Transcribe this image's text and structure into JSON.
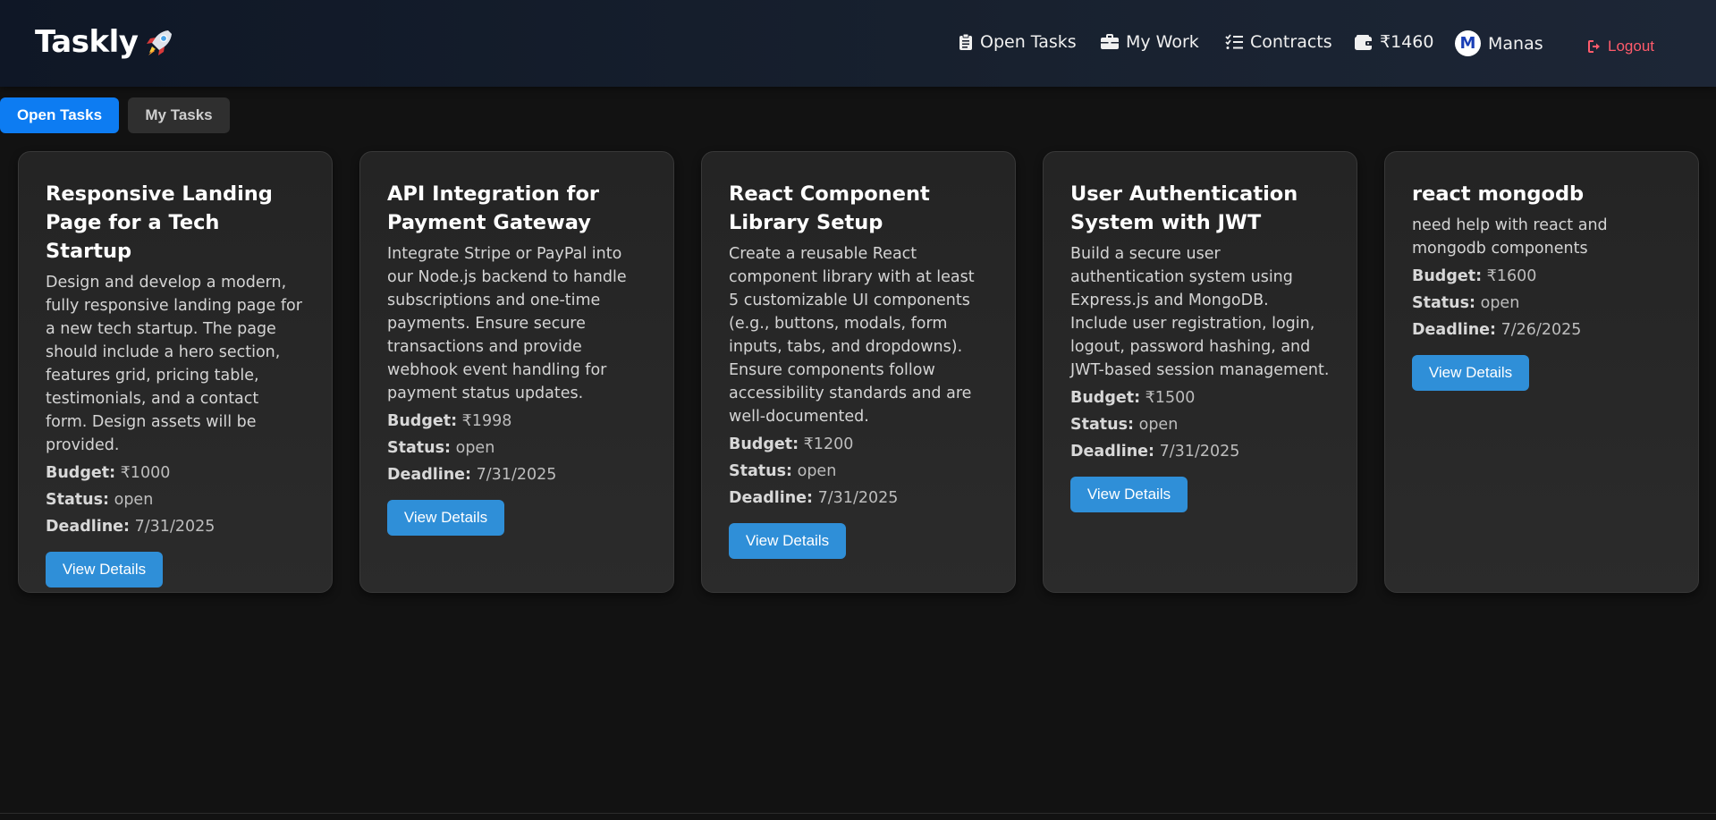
{
  "brand": {
    "name": "Taskly",
    "icon": "rocket-icon"
  },
  "nav": {
    "open_tasks": "Open Tasks",
    "my_work": "My Work",
    "contracts": "Contracts",
    "wallet": "₹1460",
    "user_initial": "M",
    "user_name": "Manas",
    "logout": "Logout"
  },
  "tabs": {
    "open": "Open Tasks",
    "mine": "My Tasks"
  },
  "labels": {
    "budget": "Budget:",
    "status": "Status:",
    "deadline": "Deadline:",
    "view": "View Details"
  },
  "tasks": [
    {
      "title": "Responsive Landing Page for a Tech Startup",
      "description": "Design and develop a modern, fully responsive landing page for a new tech startup. The page should include a hero section, features grid, pricing table, testimonials, and a contact form. Design assets will be provided.",
      "budget": "₹1000",
      "status": "open",
      "deadline": "7/31/2025"
    },
    {
      "title": "API Integration for Payment Gateway",
      "description": "Integrate Stripe or PayPal into our Node.js backend to handle subscriptions and one-time payments. Ensure secure transactions and provide webhook event handling for payment status updates.",
      "budget": "₹1998",
      "status": "open",
      "deadline": "7/31/2025"
    },
    {
      "title": "React Component Library Setup",
      "description": "Create a reusable React component library with at least 5 customizable UI components (e.g., buttons, modals, form inputs, tabs, and dropdowns). Ensure components follow accessibility standards and are well-documented.",
      "budget": "₹1200",
      "status": "open",
      "deadline": "7/31/2025"
    },
    {
      "title": "User Authentication System with JWT",
      "description": "Build a secure user authentication system using Express.js and MongoDB. Include user registration, login, logout, password hashing, and JWT-based session management.",
      "budget": "₹1500",
      "status": "open",
      "deadline": "7/31/2025"
    },
    {
      "title": "react mongodb",
      "description": "need help with react and mongodb components",
      "budget": "₹1600",
      "status": "open",
      "deadline": "7/26/2025"
    }
  ]
}
